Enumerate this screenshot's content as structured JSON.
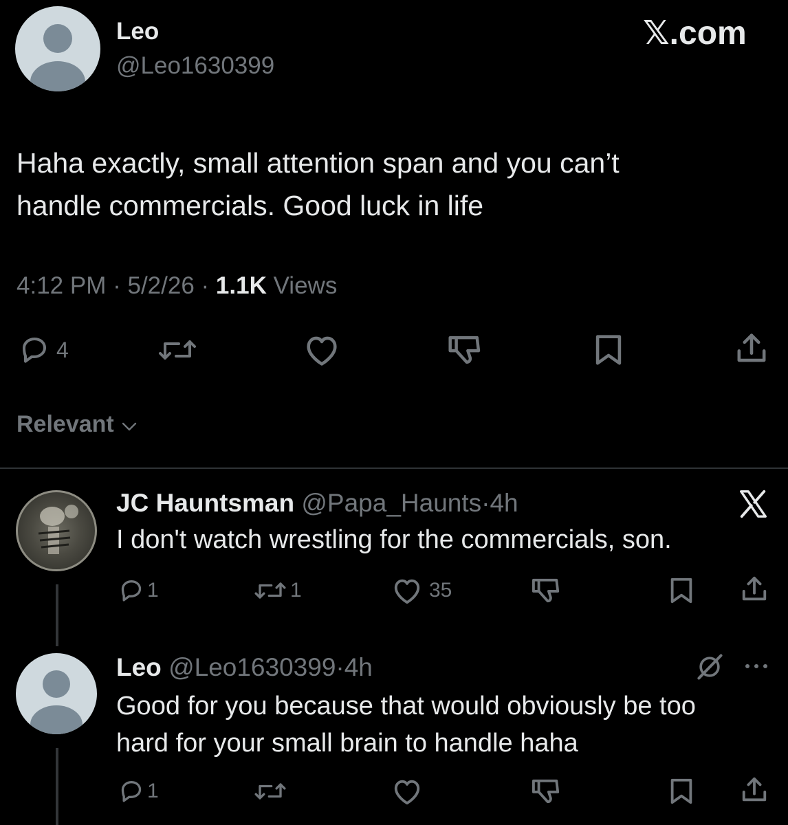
{
  "main_tweet": {
    "name": "Leo",
    "handle": "@Leo1630399",
    "text_line1": "Haha exactly, small attention span and you can’t",
    "text_line2": "handle commercials. Good luck in life",
    "time": "4:12 PM",
    "date": "5/2/26",
    "views_count": "1.1K",
    "views_label": "Views",
    "reply_count": "4"
  },
  "watermark": "𝕏.com",
  "sort": {
    "label": "Relevant"
  },
  "reply1": {
    "name": "JC Hauntsman",
    "handle": "@Papa_Haunts",
    "age": "4h",
    "text": "I don't watch wrestling for the commercials, son.",
    "reply_count": "1",
    "repost_count": "1",
    "like_count": "35"
  },
  "reply2": {
    "name": "Leo",
    "handle": "@Leo1630399",
    "age": "4h",
    "text_line1": "Good for you because that would obviously be too",
    "text_line2": "hard for your small brain to handle haha",
    "reply_count": "1"
  },
  "separator": "·",
  "icons": [
    "reply-icon",
    "repost-icon",
    "like-icon",
    "dislike-icon",
    "bookmark-icon",
    "share-icon",
    "x-logo-icon",
    "grok-icon",
    "more-icon"
  ],
  "colors": {
    "background": "#000000",
    "text": "#e7e9ea",
    "secondary": "#71767b",
    "divider": "#2f3336"
  }
}
